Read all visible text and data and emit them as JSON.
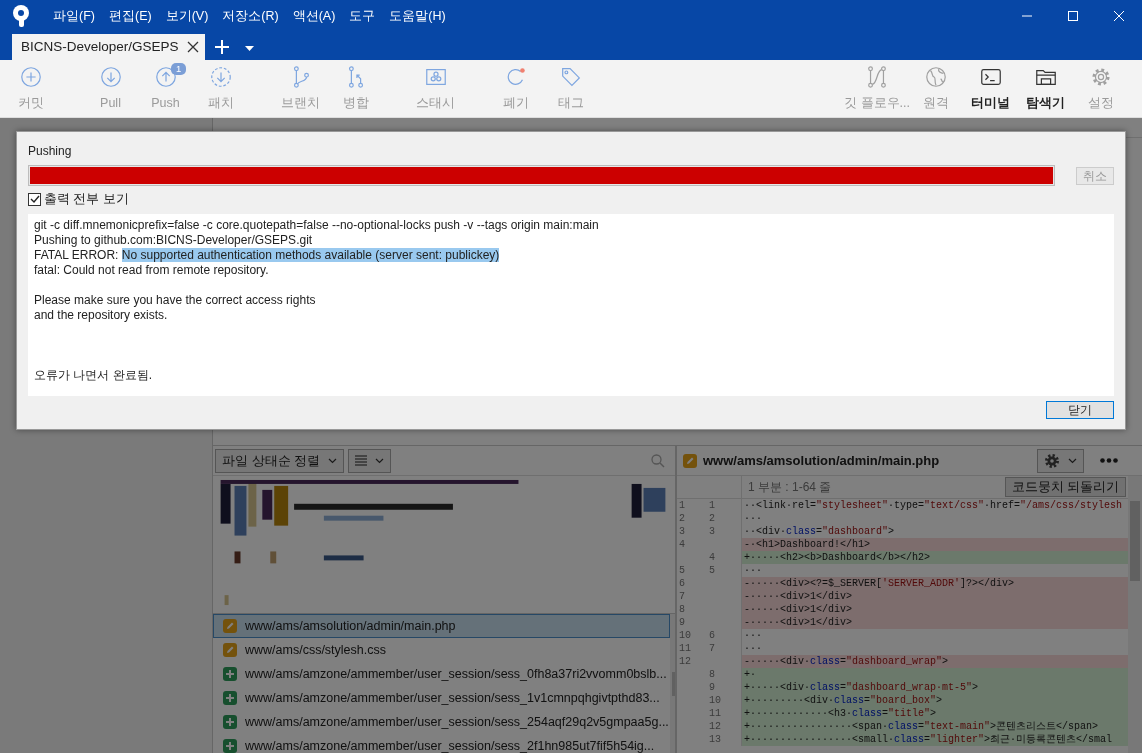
{
  "window": {
    "menus": [
      "파일(F)",
      "편집(E)",
      "보기(V)",
      "저장소(R)",
      "액션(A)",
      "도구",
      "도움말(H)"
    ]
  },
  "tabs": [
    {
      "label": "BICNS-Developer/GSEPS",
      "selected": true
    }
  ],
  "toolbar": {
    "left_groups": [
      [
        {
          "kind": "commit",
          "label": "커밋",
          "disabled": true
        }
      ],
      [
        {
          "kind": "pull",
          "label": "Pull",
          "disabled": true
        },
        {
          "kind": "push",
          "label": "Push",
          "disabled": true,
          "badge": "1"
        },
        {
          "kind": "patch",
          "label": "패치",
          "disabled": true
        }
      ],
      [
        {
          "kind": "branch",
          "label": "브랜치",
          "disabled": true
        },
        {
          "kind": "merge",
          "label": "병합",
          "disabled": true
        }
      ],
      [
        {
          "kind": "stash",
          "label": "스태시",
          "disabled": true
        }
      ],
      [
        {
          "kind": "discard",
          "label": "폐기",
          "disabled": true
        },
        {
          "kind": "tag",
          "label": "태그",
          "disabled": true
        }
      ]
    ],
    "right": [
      {
        "kind": "gitflow",
        "label": "깃 플로우...",
        "disabled": true
      },
      {
        "kind": "remote",
        "label": "원격",
        "disabled": true
      },
      {
        "kind": "terminal",
        "label": "터미널",
        "disabled": false
      },
      {
        "kind": "explorer",
        "label": "탐색기",
        "disabled": false
      },
      {
        "kind": "settings",
        "label": "설정",
        "disabled": true
      }
    ]
  },
  "dialog": {
    "title": "Pushing",
    "progress": {
      "level": 1,
      "kind": "error"
    },
    "cancel_button": {
      "label": "취소",
      "disabled": true
    },
    "show_all_output": {
      "label": "출력 전부 보기",
      "checked": true
    },
    "output_blocks": [
      {
        "kind": "command",
        "lines": [
          {
            "text": "git -c diff.mnemonicprefix=false -c core.quotepath=false --no-optional-locks push -v --tags origin main:main"
          },
          {
            "text": "Pushing to github.com:BICNS-Developer/GSEPS.git"
          },
          {
            "text": "FATAL ERROR: ",
            "selected_text": "No supported authentication methods available (server sent: publickey)"
          },
          {
            "text": "fatal: Could not read from remote repository."
          }
        ]
      },
      {
        "kind": "hint",
        "lines": [
          {
            "text": "Please make sure you have the correct access rights"
          },
          {
            "text": "and the repository exists."
          }
        ]
      },
      {
        "kind": "summary",
        "lines": [
          {
            "text": "오류가 나면서 완료됨."
          }
        ]
      }
    ],
    "close_button": "닫기"
  },
  "file_pane": {
    "sort": "파일 상태순 정렬",
    "files": [
      {
        "path": "www/ams/amsolution/admin/main.php",
        "kind": "modified",
        "selected": true
      },
      {
        "path": "www/ams/css/stylesh.css",
        "kind": "modified",
        "selected": false
      },
      {
        "path": "www/ams/amzone/ammember/user_session/sess_0fh8a37ri2vvomm0bslb...",
        "kind": "added",
        "selected": false
      },
      {
        "path": "www/ams/amzone/ammember/user_session/sess_1v1cmnpqhgivtpthd83...",
        "kind": "added",
        "selected": false
      },
      {
        "path": "www/ams/amzone/ammember/user_session/sess_254aqf29q2v5gmpaa5g...",
        "kind": "added",
        "selected": false
      },
      {
        "path": "www/ams/amzone/ammember/user_session/sess_2f1hn985ut7fif5h54ig...",
        "kind": "added",
        "selected": false
      }
    ]
  },
  "diff_pane": {
    "file": {
      "path": "www/ams/amsolution/admin/main.php",
      "kind": "modified"
    },
    "hunk": {
      "title": "1 부분 : 1-64 줄",
      "revert_button": "코드뭉치 되돌리기",
      "lines": [
        {
          "old": "1",
          "new": "1",
          "kind": "context",
          "code": [
            {
              "text": "··<link·rel="
            },
            {
              "text": "\"stylesheet\"",
              "kind": "string"
            },
            {
              "text": "·type="
            },
            {
              "text": "\"text/css\"",
              "kind": "string"
            },
            {
              "text": "·href="
            },
            {
              "text": "\"/ams/css/stylesh",
              "kind": "string"
            }
          ]
        },
        {
          "old": "2",
          "new": "2",
          "kind": "context",
          "code": [
            {
              "text": "···"
            }
          ]
        },
        {
          "old": "3",
          "new": "3",
          "kind": "context",
          "code": [
            {
              "text": "··<div·"
            },
            {
              "text": "class",
              "kind": "keyword"
            },
            {
              "text": "="
            },
            {
              "text": "\"dashboard\"",
              "kind": "string"
            },
            {
              "text": ">"
            }
          ]
        },
        {
          "old": "4",
          "kind": "removed",
          "code": [
            {
              "text": "-·<h1>Dashboard!</h1>"
            }
          ]
        },
        {
          "new": "4",
          "kind": "added",
          "code": [
            {
              "text": "+·····<h2><b>Dashboard</b></h2>"
            }
          ]
        },
        {
          "old": "5",
          "new": "5",
          "kind": "context",
          "code": [
            {
              "text": "···"
            }
          ]
        },
        {
          "old": "6",
          "kind": "removed",
          "code": [
            {
              "text": "-·····<div><?=$_SERVER["
            },
            {
              "text": "'SERVER_ADDR'",
              "kind": "string"
            },
            {
              "text": "]?></div>"
            }
          ]
        },
        {
          "old": "7",
          "kind": "removed",
          "code": [
            {
              "text": "-·····<div>1</div>"
            }
          ]
        },
        {
          "old": "8",
          "kind": "removed",
          "code": [
            {
              "text": "-·····<div>1</div>"
            }
          ]
        },
        {
          "old": "9",
          "kind": "removed",
          "code": [
            {
              "text": "-·····<div>1</div>"
            }
          ]
        },
        {
          "old": "10",
          "new": "6",
          "kind": "context",
          "code": [
            {
              "text": "···"
            }
          ]
        },
        {
          "old": "11",
          "new": "7",
          "kind": "context",
          "code": [
            {
              "text": "···"
            }
          ]
        },
        {
          "old": "12",
          "kind": "removed",
          "code": [
            {
              "text": "-·····<div·"
            },
            {
              "text": "class",
              "kind": "keyword"
            },
            {
              "text": "="
            },
            {
              "text": "\"dashboard_wrap\"",
              "kind": "string"
            },
            {
              "text": ">"
            }
          ]
        },
        {
          "new": "8",
          "kind": "added",
          "code": [
            {
              "text": "+·"
            }
          ]
        },
        {
          "new": "9",
          "kind": "added",
          "code": [
            {
              "text": "+·····<div·"
            },
            {
              "text": "class",
              "kind": "keyword"
            },
            {
              "text": "="
            },
            {
              "text": "\"dashboard_wrap·mt-5\"",
              "kind": "string"
            },
            {
              "text": ">"
            }
          ]
        },
        {
          "new": "10",
          "kind": "added",
          "code": [
            {
              "text": "+·········<div·"
            },
            {
              "text": "class",
              "kind": "keyword"
            },
            {
              "text": "="
            },
            {
              "text": "\"board_box\"",
              "kind": "string"
            },
            {
              "text": ">"
            }
          ]
        },
        {
          "new": "11",
          "kind": "added",
          "code": [
            {
              "text": "+·············<h3·"
            },
            {
              "text": "class",
              "kind": "keyword"
            },
            {
              "text": "="
            },
            {
              "text": "\"title\"",
              "kind": "string"
            },
            {
              "text": ">"
            }
          ]
        },
        {
          "new": "12",
          "kind": "added",
          "code": [
            {
              "text": "+·················<span·"
            },
            {
              "text": "class",
              "kind": "keyword"
            },
            {
              "text": "="
            },
            {
              "text": "\"text-main\"",
              "kind": "string"
            },
            {
              "text": ">콘텐츠리스트</span>"
            }
          ]
        },
        {
          "new": "13",
          "kind": "added",
          "code": [
            {
              "text": "+·················<small·"
            },
            {
              "text": "class",
              "kind": "keyword"
            },
            {
              "text": "="
            },
            {
              "text": "\"lighter\"",
              "kind": "string"
            },
            {
              "text": ">최근·미등록콘텐츠</smal"
            }
          ]
        }
      ]
    }
  }
}
